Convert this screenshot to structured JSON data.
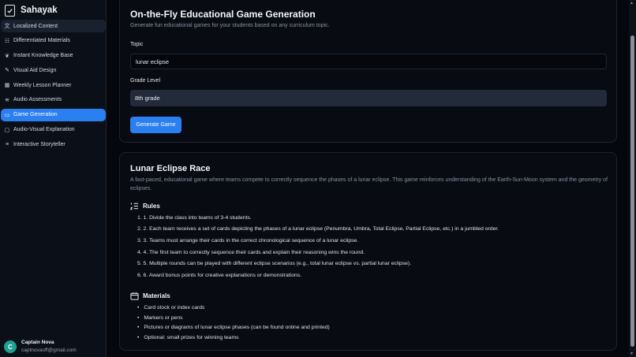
{
  "app": {
    "name": "Sahayak"
  },
  "sidebar": {
    "items": [
      {
        "label": "Localized Content",
        "icon": "translate-icon",
        "glyph": "文"
      },
      {
        "label": "Differentiated Materials",
        "icon": "users-icon",
        "glyph": "☷"
      },
      {
        "label": "Instant Knowledge Base",
        "icon": "brain-icon",
        "glyph": "❦"
      },
      {
        "label": "Visual Aid Design",
        "icon": "palette-icon",
        "glyph": "✎"
      },
      {
        "label": "Weekly Lesson Planner",
        "icon": "calendar-icon",
        "glyph": "▦"
      },
      {
        "label": "Audio Assessments",
        "icon": "audio-wave-icon",
        "glyph": "≋"
      },
      {
        "label": "Game Generation",
        "icon": "gamepad-icon",
        "glyph": "▭"
      },
      {
        "label": "Audio-Visual Explanation",
        "icon": "monitor-icon",
        "glyph": "▢"
      },
      {
        "label": "Interactive Storyteller",
        "icon": "book-icon",
        "glyph": "≡"
      }
    ]
  },
  "user": {
    "initial": "C",
    "name": "Captain Nova",
    "email": "captnovaoff@gmail.com"
  },
  "form": {
    "title": "On-the-Fly Educational Game Generation",
    "subtitle": "Generate fun educational games for your students based on any curriculum topic.",
    "topic_label": "Topic",
    "topic_value": "lunar eclipse",
    "grade_label": "Grade Level",
    "grade_value": "8th grade",
    "button_label": "Generate Game"
  },
  "game": {
    "title": "Lunar Eclipse Race",
    "description": "A fast-paced, educational game where teams compete to correctly sequence the phases of a lunar eclipse. This game reinforces understanding of the Earth-Sun-Moon system and the geometry of eclipses.",
    "rules_heading": "Rules",
    "rules": [
      "1. 1. Divide the class into teams of 3-4 students.",
      "2. 2. Each team receives a set of cards depicting the phases of a lunar eclipse (Penumbra, Umbra, Total Eclipse, Partial Eclipse, etc.) in a jumbled order.",
      "3. 3. Teams must arrange their cards in the correct chronological sequence of a lunar eclipse.",
      "4. 4. The first team to correctly sequence their cards and explain their reasoning wins the round.",
      "5. 5. Multiple rounds can be played with different eclipse scenarios (e.g., total lunar eclipse vs. partial lunar eclipse).",
      "6. 6. Award bonus points for creative explanations or demonstrations."
    ],
    "materials_heading": "Materials",
    "materials": [
      "Card stock or index cards",
      "Markers or pens",
      "Pictures or diagrams of lunar eclipse phases (can be found online and printed)",
      "Optional: small prizes for winning teams"
    ]
  },
  "colors": {
    "accent": "#2b7ff0",
    "background": "#05070d",
    "avatar": "#1f9e91"
  }
}
